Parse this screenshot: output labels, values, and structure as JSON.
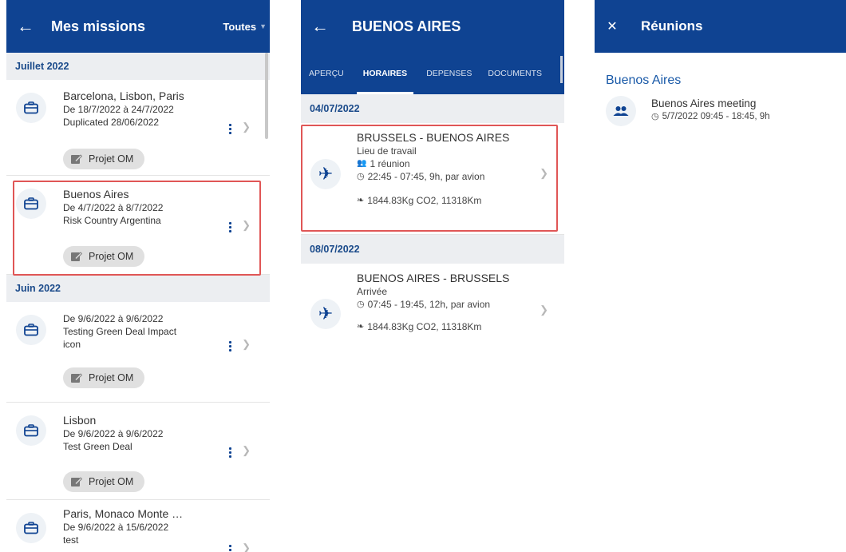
{
  "panel1": {
    "title": "Mes missions",
    "filter": "Toutes",
    "sections": [
      {
        "header": "Juillet 2022",
        "missions": [
          {
            "name": "Barcelona, Lisbon, Paris",
            "dates": "De 18/7/2022 à 24/7/2022",
            "note": "Duplicated 28/06/2022",
            "chip": "Projet OM"
          },
          {
            "name": "Buenos Aires",
            "dates": "De 4/7/2022 à 8/7/2022",
            "note": "Risk Country Argentina",
            "chip": "Projet OM"
          }
        ]
      },
      {
        "header": "Juin 2022",
        "missions": [
          {
            "name": "",
            "dates": "De 9/6/2022 à 9/6/2022",
            "note": "Testing Green Deal Impact",
            "note2": "icon",
            "chip": "Projet OM"
          },
          {
            "name": "Lisbon",
            "dates": "De 9/6/2022 à 9/6/2022",
            "note": "Test Green Deal",
            "chip": "Projet OM"
          },
          {
            "name": "Paris, Monaco Monte …",
            "dates": "De 9/6/2022 à 15/6/2022",
            "note": "test",
            "chip": ""
          }
        ]
      }
    ]
  },
  "panel2": {
    "title": "BUENOS AIRES",
    "tabs": [
      "APERÇU",
      "HORAIRES",
      "DEPENSES",
      "DOCUMENTS"
    ],
    "active_tab": "HORAIRES",
    "days": [
      {
        "date": "04/07/2022",
        "route": "BRUSSELS - BUENOS AIRES",
        "place": "Lieu de travail",
        "meetings": "1 réunion",
        "time": "22:45 - 07:45, 9h, par avion",
        "co2": "1844.83Kg CO2, 11318Km"
      },
      {
        "date": "08/07/2022",
        "route": "BUENOS AIRES - BRUSSELS",
        "place": "Arrivée",
        "time": "07:45 - 19:45, 12h, par avion",
        "co2": "1844.83Kg CO2, 11318Km"
      }
    ]
  },
  "panel3": {
    "title": "Réunions",
    "city": "Buenos Aires",
    "meeting": {
      "name": "Buenos Aires meeting",
      "time": "5/7/2022 09:45 - 18:45, 9h"
    }
  },
  "colors": {
    "brand": "#0f4392",
    "highlight": "#e05656",
    "section_bg": "#eceef1"
  },
  "icons": [
    "back-arrow-icon",
    "briefcase-icon",
    "kebab-menu-icon",
    "chevron-right-icon",
    "edit-note-icon",
    "plane-icon",
    "people-icon",
    "clock-icon",
    "footprint-icon",
    "close-icon"
  ]
}
